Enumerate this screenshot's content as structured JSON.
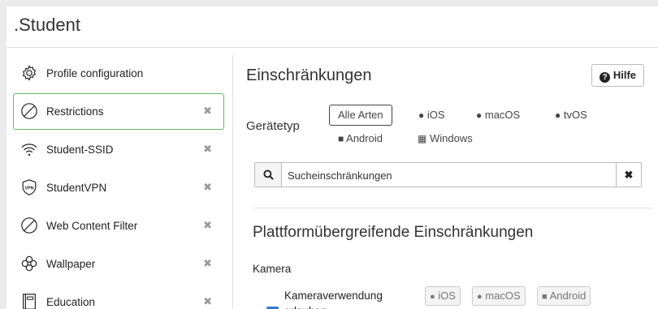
{
  "page": {
    "title": ".Student"
  },
  "sidebar": {
    "items": [
      {
        "label": "Profile configuration",
        "icon": "gear-icon",
        "removable": false
      },
      {
        "label": "Restrictions",
        "icon": "prohibited-icon",
        "removable": true,
        "active": true
      },
      {
        "label": "Student-SSID",
        "icon": "wifi-icon",
        "removable": true
      },
      {
        "label": "StudentVPN",
        "icon": "vpn-shield-icon",
        "removable": true
      },
      {
        "label": "Web Content Filter",
        "icon": "prohibited-icon",
        "removable": true
      },
      {
        "label": "Wallpaper",
        "icon": "flower-icon",
        "removable": true
      },
      {
        "label": "Education",
        "icon": "notebook-icon",
        "removable": true
      }
    ],
    "remove_glyph": "✖"
  },
  "main": {
    "heading": "Einschränkungen",
    "help_label": "Hilfe",
    "device_type_label": "Gerätetyp",
    "device_types": [
      "Alle Arten",
      "iOS",
      "macOS",
      "tvOS",
      "Android",
      "Windows"
    ],
    "search_placeholder": "Sucheinschränkungen",
    "clear_glyph": "✖",
    "section_heading": "Plattformübergreifende Einschränkungen",
    "subsection": "Kamera",
    "camera_checkbox_label": "Kameraverwendung erlauben",
    "camera_checked": true,
    "platform_tags": [
      "iOS",
      "macOS",
      "Android"
    ]
  },
  "colors": {
    "active_border": "#6cb56c",
    "checkbox": "#3478d4"
  }
}
